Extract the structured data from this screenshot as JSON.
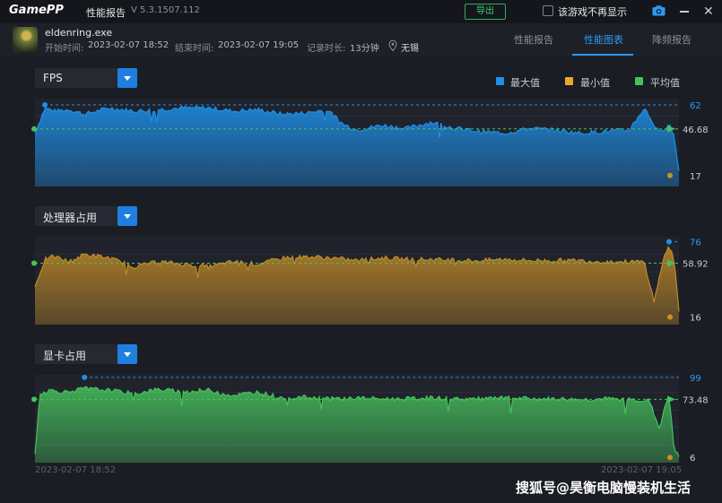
{
  "app": {
    "logo": "GamePP",
    "window_title": "性能报告",
    "version": "V 5.3.1507.112",
    "export_label": "导出",
    "hide_label": "该游戏不再显示"
  },
  "game": {
    "exe_name": "eldenring.exe",
    "start_label": "开始时间:",
    "start_time": "2023-02-07 18:52",
    "end_label": "结束时间:",
    "end_time": "2023-02-07 19:05",
    "duration_label": "记录时长:",
    "duration": "13分钟",
    "location": "无锡"
  },
  "tabs": [
    {
      "label": "性能报告",
      "active": false
    },
    {
      "label": "性能图表",
      "active": true
    },
    {
      "label": "降频报告",
      "active": false
    }
  ],
  "legend": [
    {
      "label": "最大值",
      "color": "#1e90e8"
    },
    {
      "label": "最小值",
      "color": "#e8a82a"
    },
    {
      "label": "平均值",
      "color": "#46c25c"
    }
  ],
  "charts": [
    {
      "selector_label": "FPS",
      "max_label": "62",
      "avg_label": "46.68",
      "min_label": "17",
      "color": "#1e90e8"
    },
    {
      "selector_label": "处理器占用",
      "max_label": "76",
      "avg_label": "58.92",
      "min_label": "16",
      "color": "#c08a28"
    },
    {
      "selector_label": "显卡占用",
      "max_label": "99",
      "avg_label": "73.48",
      "min_label": "6",
      "color": "#46c25c"
    }
  ],
  "chart_data": [
    {
      "type": "area",
      "title": "FPS",
      "x_range": [
        "2023-02-07 18:52",
        "2023-02-07 19:05"
      ],
      "x_minutes": [
        0,
        0.2,
        0.4,
        0.7,
        1,
        1.5,
        2,
        2.5,
        3,
        3.5,
        4,
        4.5,
        5,
        5.5,
        5.9,
        6.2,
        6.5,
        7,
        7.5,
        8,
        8.5,
        9,
        9.5,
        10,
        10.5,
        11,
        11.5,
        12,
        12.3,
        12.6,
        12.8,
        12.9,
        13
      ],
      "values": [
        44,
        60,
        58,
        59,
        56,
        60,
        58,
        59,
        60,
        60,
        58,
        59,
        56,
        57,
        59,
        50,
        46,
        49,
        47,
        51,
        47,
        45,
        44,
        47,
        46,
        44,
        45,
        46,
        60,
        44,
        50,
        42,
        20
      ],
      "max": 62,
      "avg": 46.68,
      "min": 17
    },
    {
      "type": "area",
      "title": "处理器占用",
      "x_range": [
        "2023-02-07 18:52",
        "2023-02-07 19:05"
      ],
      "x_minutes": [
        0,
        0.2,
        0.4,
        0.7,
        1,
        1.5,
        2,
        2.5,
        3,
        3.5,
        4,
        4.5,
        5,
        5.5,
        6,
        6.5,
        7,
        7.5,
        8,
        8.5,
        9,
        9.5,
        10,
        10.5,
        11,
        11.5,
        12,
        12.3,
        12.5,
        12.7,
        12.8,
        12.9,
        13
      ],
      "values": [
        40,
        62,
        64,
        60,
        66,
        63,
        56,
        60,
        58,
        56,
        60,
        58,
        63,
        64,
        63,
        61,
        63,
        62,
        62,
        61,
        61,
        62,
        61,
        61,
        61,
        60,
        60,
        60,
        28,
        65,
        72,
        62,
        20
      ],
      "max": 76,
      "avg": 58.92,
      "min": 16
    },
    {
      "type": "area",
      "title": "显卡占用",
      "x_range": [
        "2023-02-07 18:52",
        "2023-02-07 19:05"
      ],
      "x_minutes": [
        0,
        0.1,
        0.3,
        0.6,
        1,
        1.5,
        2,
        2.5,
        3,
        3.5,
        4,
        4.5,
        5,
        5.5,
        6,
        6.5,
        7,
        7.5,
        8,
        8.5,
        9,
        9.5,
        10,
        10.5,
        11,
        11.5,
        12,
        12.4,
        12.6,
        12.7,
        12.8,
        12.9,
        13
      ],
      "values": [
        10,
        80,
        84,
        82,
        86,
        84,
        80,
        85,
        82,
        84,
        78,
        82,
        75,
        76,
        74,
        75,
        74,
        74,
        75,
        74,
        74,
        75,
        74,
        74,
        73,
        74,
        73,
        72,
        40,
        60,
        80,
        15,
        8
      ],
      "max": 99,
      "avg": 73.48,
      "min": 6
    }
  ],
  "dates": {
    "start": "2023-02-07 18:52",
    "end": "2023-02-07 19:05"
  },
  "watermark": "搜狐号@昊衡电脑慢装机生活"
}
